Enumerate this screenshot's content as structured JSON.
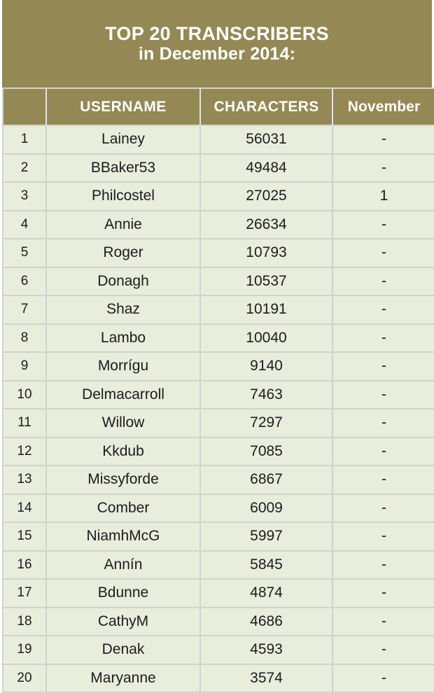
{
  "title": {
    "line1": "TOP 20 TRANSCRIBERS",
    "line2": "in December 2014:"
  },
  "colors": {
    "banner_background": "#948954",
    "header_background": "#948954",
    "header_text": "#ffffff",
    "cell_background": "#e8eddc",
    "cell_text": "#1c1c1c",
    "border": "#d2d4cc",
    "page_background": "#ffffff"
  },
  "table": {
    "columns": [
      {
        "key": "rank",
        "label": ""
      },
      {
        "key": "username",
        "label": "USERNAME"
      },
      {
        "key": "characters",
        "label": "CHARACTERS"
      },
      {
        "key": "november",
        "label": "November"
      }
    ],
    "rows": [
      {
        "rank": "1",
        "username": "Lainey",
        "characters": "56031",
        "november": "-"
      },
      {
        "rank": "2",
        "username": "BBaker53",
        "characters": "49484",
        "november": "-"
      },
      {
        "rank": "3",
        "username": "Philcostel",
        "characters": "27025",
        "november": "1"
      },
      {
        "rank": "4",
        "username": "Annie",
        "characters": "26634",
        "november": "-"
      },
      {
        "rank": "5",
        "username": "Roger",
        "characters": "10793",
        "november": "-"
      },
      {
        "rank": "6",
        "username": "Donagh",
        "characters": "10537",
        "november": "-"
      },
      {
        "rank": "7",
        "username": "Shaz",
        "characters": "10191",
        "november": "-"
      },
      {
        "rank": "8",
        "username": "Lambo",
        "characters": "10040",
        "november": "-"
      },
      {
        "rank": "9",
        "username": "Morrígu",
        "characters": "9140",
        "november": "-"
      },
      {
        "rank": "10",
        "username": "Delmacarroll",
        "characters": "7463",
        "november": "-"
      },
      {
        "rank": "11",
        "username": "Willow",
        "characters": "7297",
        "november": "-"
      },
      {
        "rank": "12",
        "username": "Kkdub",
        "characters": "7085",
        "november": "-"
      },
      {
        "rank": "13",
        "username": "Missyforde",
        "characters": "6867",
        "november": "-"
      },
      {
        "rank": "14",
        "username": "Comber",
        "characters": "6009",
        "november": "-"
      },
      {
        "rank": "15",
        "username": "NiamhMcG",
        "characters": "5997",
        "november": "-"
      },
      {
        "rank": "16",
        "username": "Annín",
        "characters": "5845",
        "november": "-"
      },
      {
        "rank": "17",
        "username": "Bdunne",
        "characters": "4874",
        "november": "-"
      },
      {
        "rank": "18",
        "username": "CathyM",
        "characters": "4686",
        "november": "-"
      },
      {
        "rank": "19",
        "username": "Denak",
        "characters": "4593",
        "november": "-"
      },
      {
        "rank": "20",
        "username": "Maryanne",
        "characters": "3574",
        "november": "-"
      }
    ]
  }
}
